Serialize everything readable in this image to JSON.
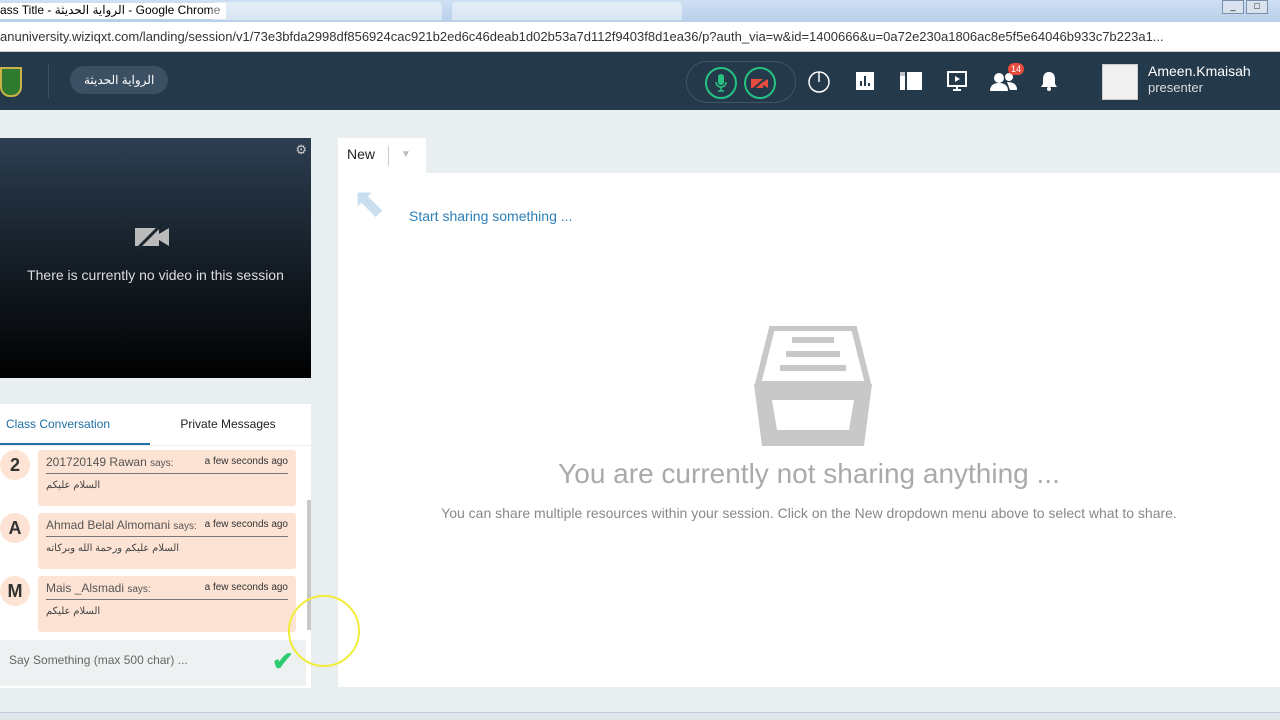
{
  "browser": {
    "title": "ass Title - الرواية الحديثة - Google Chrome",
    "url": "anuniversity.wiziqxt.com/landing/session/v1/73e3bfda2998df856924cac921b2ed6c46deab1d02b53a7d112f9403f8d1ea36/p?auth_via=w&id=1400666&u=0a72e230a1806ac8e5f5e64046b933c7b223a1..."
  },
  "header": {
    "room_name": "الرواية الحديثة",
    "participants_badge": "14",
    "user_name": "Ameen.Kmaisah",
    "user_role": "presenter",
    "icons": [
      "mic-icon",
      "video-off-icon",
      "timer-icon",
      "poll-icon",
      "whiteboard-icon",
      "screen-share-icon",
      "participants-icon",
      "bell-icon"
    ]
  },
  "video": {
    "message": "There is currently no video in this session"
  },
  "chat": {
    "tabs": [
      "Class Conversation",
      "Private Messages"
    ],
    "messages": [
      {
        "initial": "2",
        "name": "201720149 Rawan",
        "says": "says:",
        "time": "a few seconds ago",
        "text": "السلام عليكم"
      },
      {
        "initial": "A",
        "name": "Ahmad Belal Almomani",
        "says": "says:",
        "time": "a few seconds ago",
        "text": "السلام عليكم ورحمة الله وبركاته"
      },
      {
        "initial": "M",
        "name": "Mais _Alsmadi",
        "says": "says:",
        "time": "a few seconds ago",
        "text": "السلام عليكم"
      }
    ],
    "placeholder": "Say Something (max 500 char) ..."
  },
  "content": {
    "new_tab": "New",
    "start_sharing": "Start sharing something ...",
    "empty_title": "You are currently not sharing anything ...",
    "empty_desc": "You can share multiple resources within your session. Click on the New dropdown menu above to select what to share."
  },
  "colors": {
    "nav": "#24394a",
    "accent": "#1d6fa5",
    "mic": "#26c281",
    "bubble": "#fde3d3"
  }
}
